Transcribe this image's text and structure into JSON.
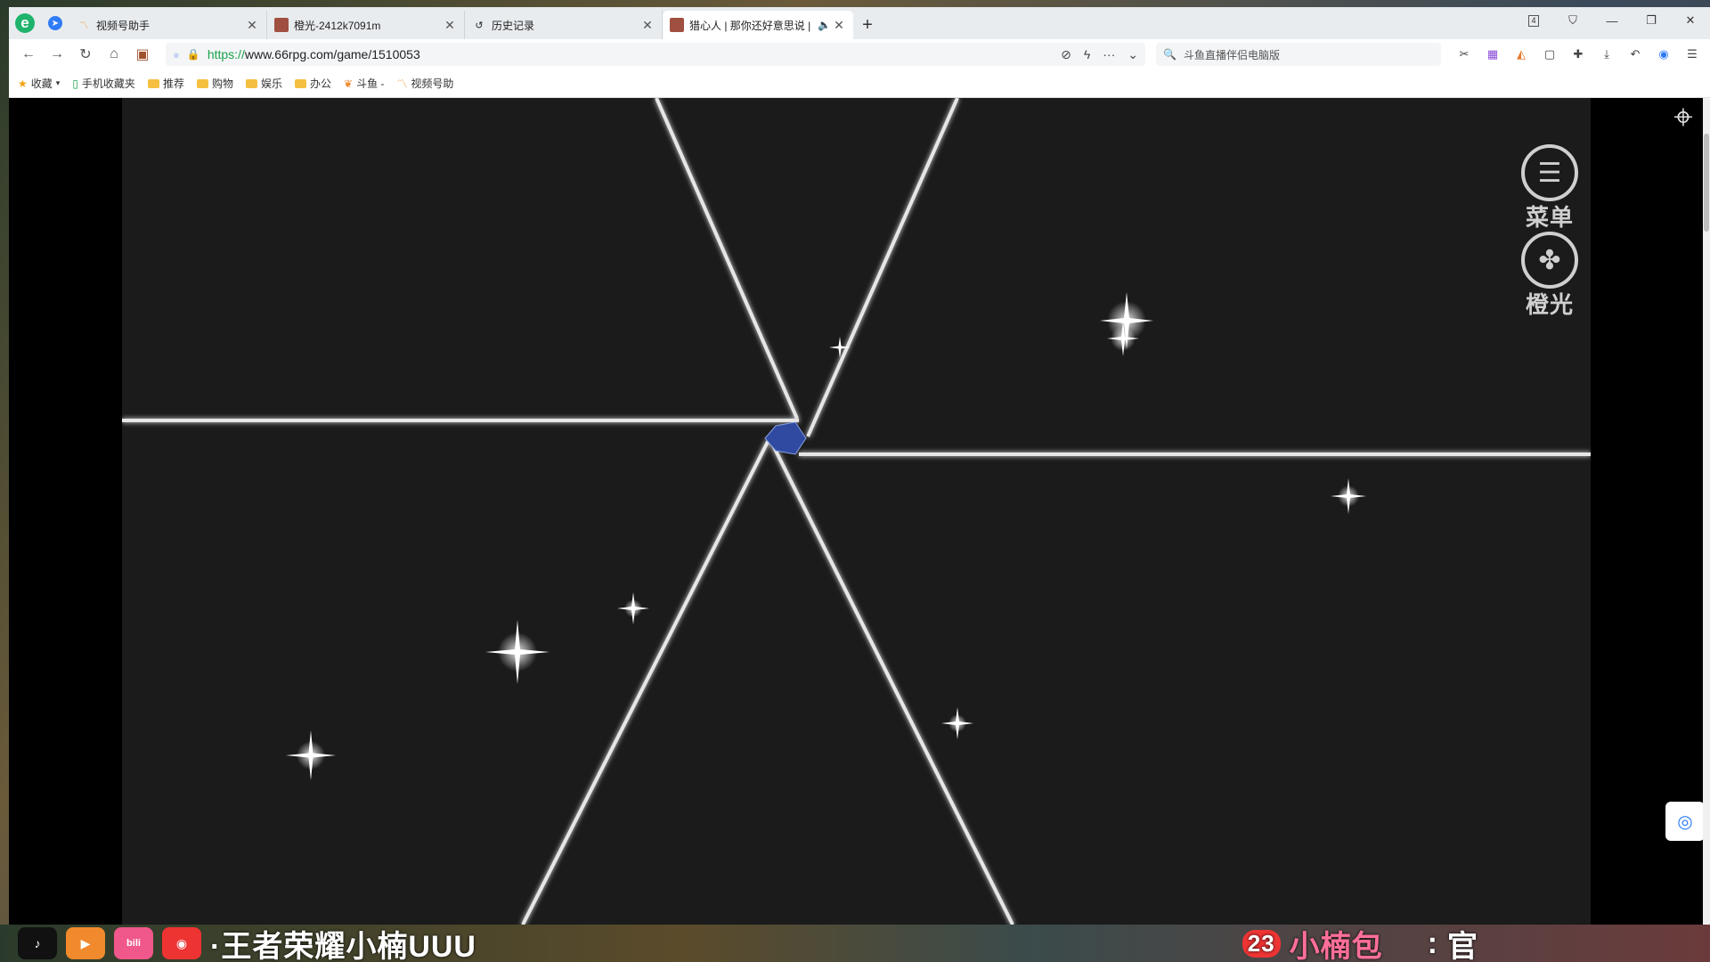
{
  "browser": {
    "tabs": [
      {
        "title": "视频号助手",
        "favicon": "heart-wave-icon",
        "active": false
      },
      {
        "title": "橙光-2412k7091m",
        "favicon": "avatar-icon",
        "active": false
      },
      {
        "title": "历史记录",
        "favicon": "history-icon",
        "active": false
      },
      {
        "title": "猎心人 | 那你还好意思说 |",
        "favicon": "avatar-icon",
        "active": true
      }
    ],
    "tab_count_badge": "4",
    "url_proto": "https://",
    "url_rest": "www.66rpg.com/game/1510053",
    "search_placeholder": "斗鱼直播伴侣电脑版",
    "bookmarks": [
      {
        "label": "收藏",
        "icon": "star-icon"
      },
      {
        "label": "手机收藏夹",
        "icon": "phone-icon"
      },
      {
        "label": "推荐",
        "icon": "folder-icon"
      },
      {
        "label": "购物",
        "icon": "folder-icon"
      },
      {
        "label": "娱乐",
        "icon": "folder-icon"
      },
      {
        "label": "办公",
        "icon": "folder-icon"
      },
      {
        "label": "斗鱼 -",
        "icon": "douyu-icon"
      },
      {
        "label": "视频号助",
        "icon": "heart-wave-icon"
      }
    ]
  },
  "game": {
    "menu_label": "菜单",
    "orange_label": "橙光",
    "colors": {
      "background": "#1b1b1b",
      "line": "#e6e6e6",
      "gem": "#2f4aa0"
    }
  },
  "bottom_strip": {
    "left_text": "·王者荣耀小楠UUU",
    "badge_num": "23",
    "right_pink": "小楠包",
    "right_text": "官"
  }
}
